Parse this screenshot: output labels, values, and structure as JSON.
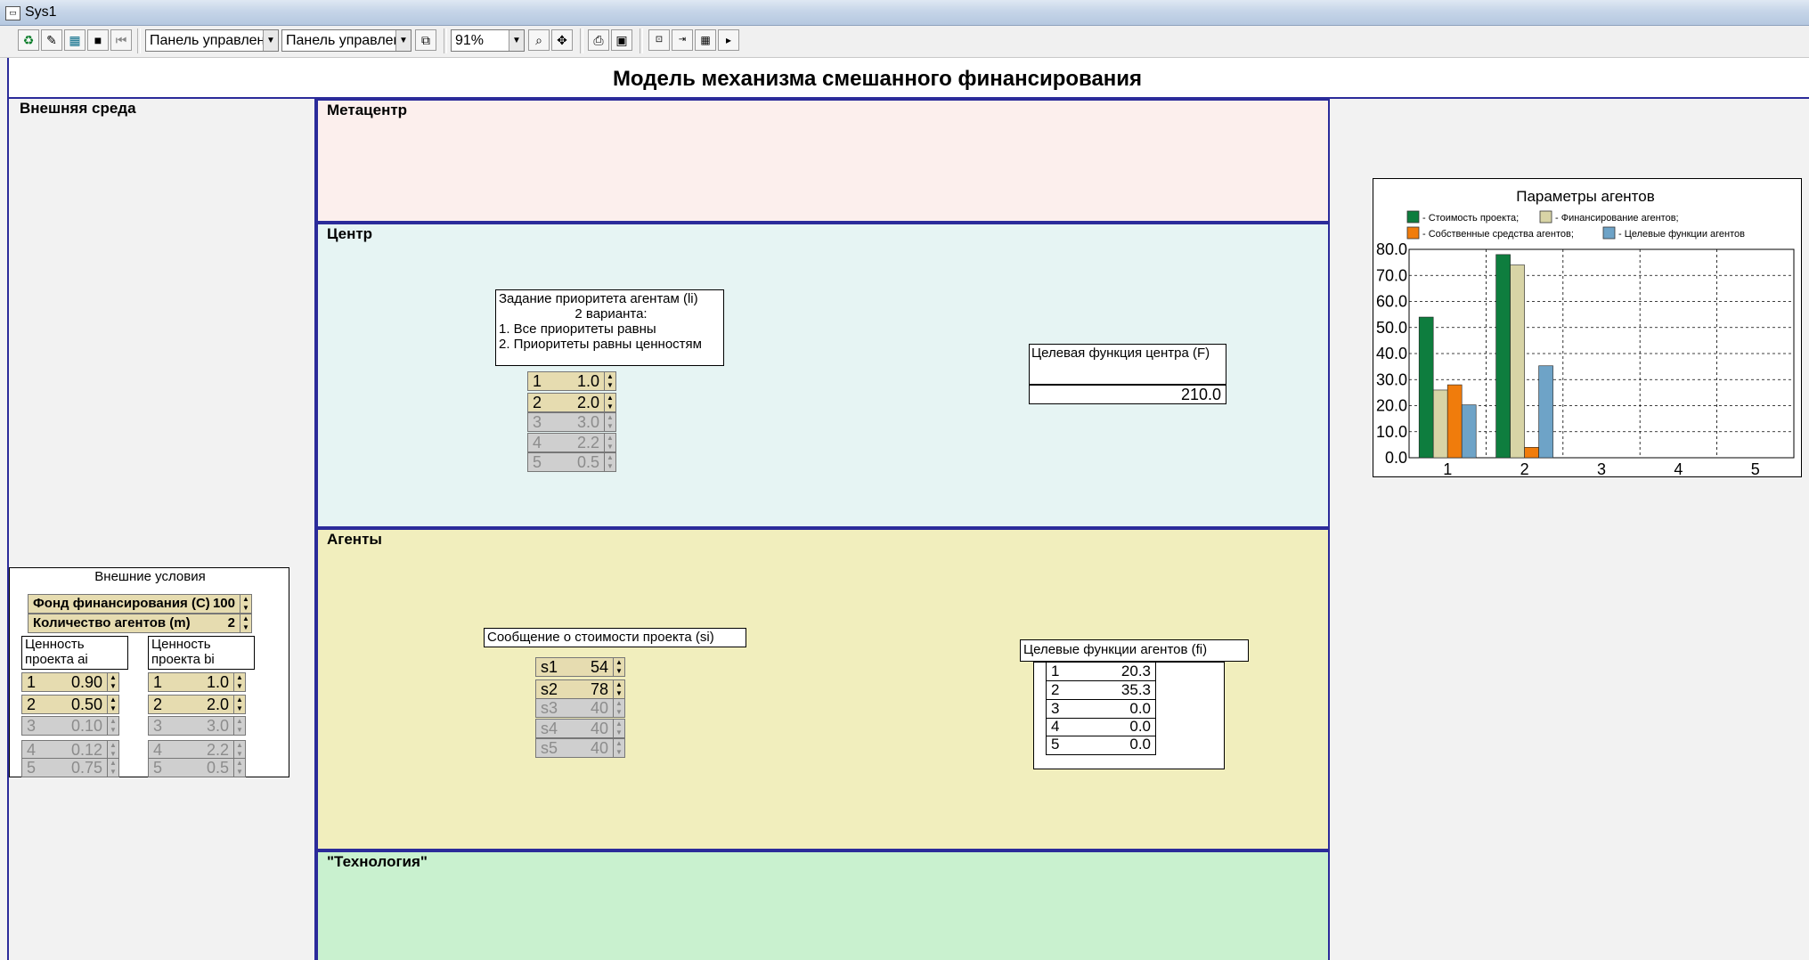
{
  "window": {
    "title": "Sys1"
  },
  "toolbar": {
    "combo1": "Панель управлен",
    "combo2": "Панель управлен",
    "zoom": "91%"
  },
  "page": {
    "title": "Модель механизма смешанного финансирования"
  },
  "regions": {
    "external": "Внешняя среда",
    "metacenter": "Метацентр",
    "center": "Центр",
    "agents": "Агенты",
    "technology": "\"Технология\""
  },
  "external_conditions": {
    "title": "Внешние условия",
    "fund_label": "Фонд финансирования (С)",
    "fund_value": "100",
    "agents_label": "Количество агентов (m)",
    "agents_value": "2",
    "col_a_header_line1": "Ценность",
    "col_a_header_line2": "проекта ai",
    "col_b_header_line1": "Ценность",
    "col_b_header_line2": "проекта bi",
    "a_values": [
      {
        "k": "1",
        "v": "0.90"
      },
      {
        "k": "2",
        "v": "0.50"
      },
      {
        "k": "3",
        "v": "0.10"
      },
      {
        "k": "4",
        "v": "0.12"
      },
      {
        "k": "5",
        "v": "0.75"
      }
    ],
    "b_values": [
      {
        "k": "1",
        "v": "1.0"
      },
      {
        "k": "2",
        "v": "2.0"
      },
      {
        "k": "3",
        "v": "3.0"
      },
      {
        "k": "4",
        "v": "2.2"
      },
      {
        "k": "5",
        "v": "0.5"
      }
    ]
  },
  "center": {
    "priority_title": "Задание приоритета агентам (li)",
    "priority_line2": "2 варианта:",
    "priority_line3": "1. Все приоритеты равны",
    "priority_line4": "2. Приоритеты равны ценностям",
    "priorities": [
      {
        "k": "1",
        "v": "1.0"
      },
      {
        "k": "2",
        "v": "2.0"
      },
      {
        "k": "3",
        "v": "3.0"
      },
      {
        "k": "4",
        "v": "2.2"
      },
      {
        "k": "5",
        "v": "0.5"
      }
    ],
    "objective_label": "Целевая функция центра (F)",
    "objective_value": "210.0"
  },
  "agents": {
    "cost_msg_label": "Сообщение о стоимости проекта (si)",
    "costs": [
      {
        "k": "s1",
        "v": "54"
      },
      {
        "k": "s2",
        "v": "78"
      },
      {
        "k": "s3",
        "v": "40"
      },
      {
        "k": "s4",
        "v": "40"
      },
      {
        "k": "s5",
        "v": "40"
      }
    ],
    "objective_label": "Целевые функции агентов (fi)",
    "objectives": [
      {
        "k": "1",
        "v": "20.3"
      },
      {
        "k": "2",
        "v": "35.3"
      },
      {
        "k": "3",
        "v": "0.0"
      },
      {
        "k": "4",
        "v": "0.0"
      },
      {
        "k": "5",
        "v": "0.0"
      }
    ]
  },
  "chart_data": {
    "type": "bar",
    "title": "Параметры агентов",
    "categories": [
      "1",
      "2",
      "3",
      "4",
      "5"
    ],
    "series": [
      {
        "name": "- Стоимость проекта;",
        "color": "#0e7d3e",
        "values": [
          54,
          78,
          0,
          0,
          0
        ]
      },
      {
        "name": "- Финансирование агентов;",
        "color": "#d8d4a6",
        "values": [
          26,
          74,
          0,
          0,
          0
        ]
      },
      {
        "name": "- Собственные средства агентов;",
        "color": "#f07c0c",
        "values": [
          28,
          4,
          0,
          0,
          0
        ]
      },
      {
        "name": "- Целевые функции агентов",
        "color": "#6ea3c7",
        "values": [
          20.3,
          35.3,
          0,
          0,
          0
        ]
      }
    ],
    "ylim": [
      0,
      80
    ],
    "yticks": [
      "0.0",
      "10.0",
      "20.0",
      "30.0",
      "40.0",
      "50.0",
      "60.0",
      "70.0",
      "80.0"
    ],
    "grid": true,
    "legend_position": "top"
  }
}
